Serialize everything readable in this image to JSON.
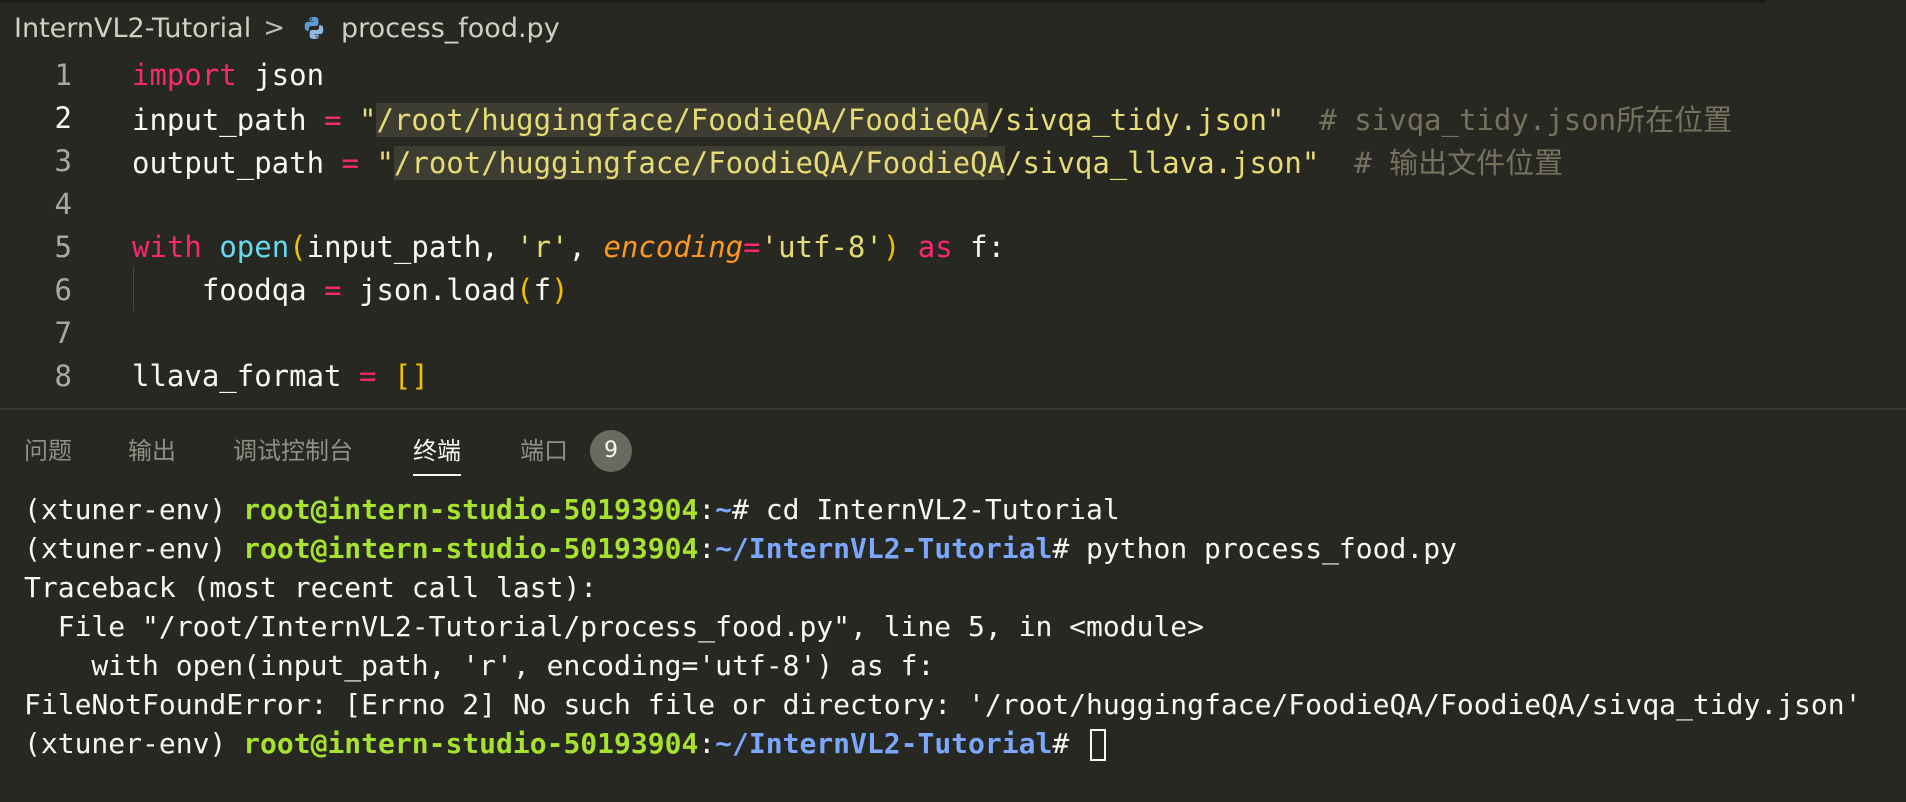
{
  "breadcrumb": {
    "folder": "InternVL2-Tutorial",
    "separator": ">",
    "file": "process_food.py",
    "file_icon": "python-icon"
  },
  "editor": {
    "active_line": 2,
    "lines": [
      {
        "n": "1",
        "tokens": [
          [
            "kw",
            "import"
          ],
          [
            "plain",
            " json"
          ]
        ]
      },
      {
        "n": "2",
        "tokens": [
          [
            "plain",
            "input_path "
          ],
          [
            "op",
            "="
          ],
          [
            "plain",
            " "
          ],
          [
            "str",
            "\""
          ],
          [
            "strhl",
            "/root/huggingface/FoodieQA/FoodieQA"
          ],
          [
            "str",
            "/sivqa_tidy.json\""
          ],
          [
            "plain",
            "  "
          ],
          [
            "cm",
            "# sivqa_tidy.json所在位置"
          ]
        ]
      },
      {
        "n": "3",
        "tokens": [
          [
            "plain",
            "output_path "
          ],
          [
            "op",
            "="
          ],
          [
            "plain",
            " "
          ],
          [
            "str",
            "\""
          ],
          [
            "strhl",
            "/root/huggingface/FoodieQA/FoodieQA"
          ],
          [
            "str",
            "/sivqa_llava.json\""
          ],
          [
            "plain",
            "  "
          ],
          [
            "cm",
            "# 输出文件位置"
          ]
        ]
      },
      {
        "n": "4",
        "tokens": []
      },
      {
        "n": "5",
        "tokens": [
          [
            "kw",
            "with"
          ],
          [
            "plain",
            " "
          ],
          [
            "fn",
            "open"
          ],
          [
            "br",
            "("
          ],
          [
            "plain",
            "input_path, "
          ],
          [
            "str",
            "'r'"
          ],
          [
            "plain",
            ", "
          ],
          [
            "param",
            "encoding"
          ],
          [
            "op",
            "="
          ],
          [
            "str",
            "'utf-8'"
          ],
          [
            "br",
            ")"
          ],
          [
            "plain",
            " "
          ],
          [
            "kw",
            "as"
          ],
          [
            "plain",
            " f:"
          ]
        ]
      },
      {
        "n": "6",
        "tokens": [
          [
            "plain",
            "    foodqa "
          ],
          [
            "op",
            "="
          ],
          [
            "plain",
            " json.load"
          ],
          [
            "br",
            "("
          ],
          [
            "plain",
            "f"
          ],
          [
            "br",
            ")"
          ]
        ]
      },
      {
        "n": "7",
        "tokens": []
      },
      {
        "n": "8",
        "tokens": [
          [
            "plain",
            "llava_format "
          ],
          [
            "op",
            "="
          ],
          [
            "plain",
            " "
          ],
          [
            "br",
            "[]"
          ]
        ]
      }
    ]
  },
  "panel": {
    "tabs": [
      {
        "label": "问题",
        "active": false
      },
      {
        "label": "输出",
        "active": false
      },
      {
        "label": "调试控制台",
        "active": false
      },
      {
        "label": "终端",
        "active": true
      },
      {
        "label": "端口",
        "active": false
      }
    ],
    "ports_badge": "9"
  },
  "terminal": {
    "env": "(xtuner-env) ",
    "user": "root@intern-studio-50193904",
    "lines": [
      {
        "kind": "prompt",
        "path": "~",
        "cmd": "# cd InternVL2-Tutorial"
      },
      {
        "kind": "prompt",
        "path": "~/InternVL2-Tutorial",
        "cmd": "# python process_food.py"
      },
      {
        "kind": "text",
        "text": "Traceback (most recent call last):"
      },
      {
        "kind": "text",
        "text": "  File \"/root/InternVL2-Tutorial/process_food.py\", line 5, in <module>"
      },
      {
        "kind": "text",
        "text": "    with open(input_path, 'r', encoding='utf-8') as f:"
      },
      {
        "kind": "text",
        "text": "FileNotFoundError: [Errno 2] No such file or directory: '/root/huggingface/FoodieQA/FoodieQA/sivqa_tidy.json'"
      },
      {
        "kind": "prompt",
        "path": "~/InternVL2-Tutorial",
        "cmd": "# ",
        "cursor": true
      }
    ]
  },
  "colors": {
    "background": "#272822",
    "keyword": "#f92672",
    "string": "#e6db74",
    "function": "#66d9ef",
    "comment": "#75715e",
    "terminal_user": "#a6e22e",
    "terminal_path": "#7ba7ff"
  }
}
